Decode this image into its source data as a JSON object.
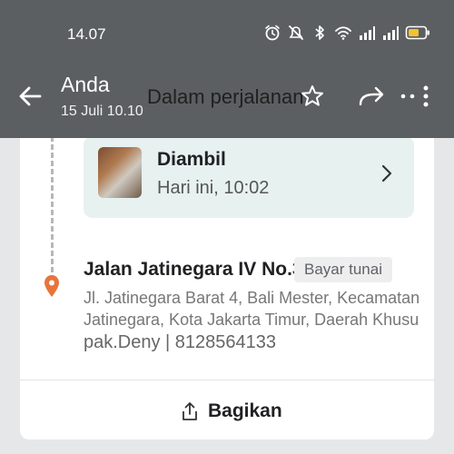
{
  "status_bar": {
    "time": "14.07",
    "icons": [
      "alarm-icon",
      "mute-icon",
      "bluetooth-icon",
      "wifi-icon",
      "signal-icon",
      "signal-icon",
      "battery-icon"
    ]
  },
  "toolbar": {
    "user_name": "Anda",
    "date": "15 Juli 10.10",
    "title": "Dalam perjalanan"
  },
  "delivery": {
    "status_title": "Diambil",
    "status_time": "Hari ini, 10:02",
    "address_title": "Jalan Jatinegara IV No.3c",
    "payment_badge": "Bayar tunai",
    "address_line1": "Jl. Jatinegara Barat 4, Bali Mester, Kecamatan",
    "address_line2": "Jatinegara, Kota Jakarta Timur, Daerah Khusus...",
    "contact": "pak.Deny | 8128564133"
  },
  "actions": {
    "share_label": "Bagikan"
  },
  "colors": {
    "overlay": "#5c5f61",
    "status_box": "#e7f1f0",
    "pin": "#e8743b",
    "battery": "#f2c230"
  }
}
